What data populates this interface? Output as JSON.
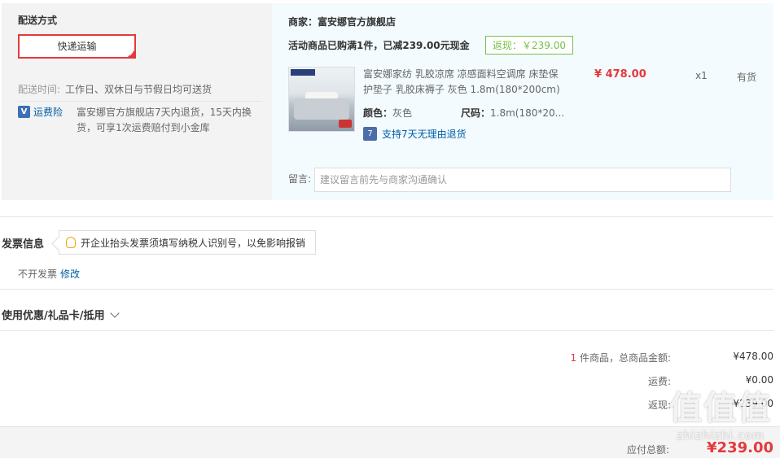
{
  "delivery": {
    "title": "配送方式",
    "method": "快递运输",
    "time_label": "配送时间:",
    "time_value": "工作日、双休日与节假日均可送货",
    "insurance_label": "运费险",
    "insurance_text": "富安娜官方旗舰店7天内退货，15天内换货，可享1次运费赔付到小金库"
  },
  "shop": {
    "merchant": "商家：富安娜官方旗舰店",
    "promo": "活动商品已购满1件，已减239.00元现金",
    "rebate_tag": "返现：￥239.00",
    "goods": {
      "name": "富安娜家纺 乳胶凉席 凉感面料空调席 床垫保护垫子 乳胶床褥子 灰色 1.8m(180*200cm)",
      "color_label": "颜色：",
      "color_value": "灰色",
      "size_label": "尺码：",
      "size_value": "1.8m(180*20...",
      "return_policy": "支持7天无理由退货",
      "return_icon": "7",
      "price": "¥ 478.00",
      "qty": "x1",
      "stock": "有货"
    },
    "message_label": "留言:",
    "message_placeholder": "建议留言前先与商家沟通确认"
  },
  "invoice": {
    "title": "发票信息",
    "tip": "开企业抬头发票须填写纳税人识别号，以免影响报销",
    "value": "不开发票",
    "edit": "修改"
  },
  "coupon": {
    "title": "使用优惠/礼品卡/抵用"
  },
  "summary": {
    "count": "1",
    "count_label": " 件商品，总商品金额:",
    "goods_amount": "¥478.00",
    "freight_label": "运费:",
    "freight": "¥0.00",
    "rebate_label": "返现:",
    "rebate": "-¥239.00",
    "total_label": "应付总额:",
    "total": "¥239.00"
  },
  "watermark": {
    "big": "值值值",
    "small": "zhizhizhi.com"
  },
  "colors": {
    "accent_red": "#e4393c",
    "link_blue": "#005ea7",
    "rebate_green": "#74c04a"
  }
}
